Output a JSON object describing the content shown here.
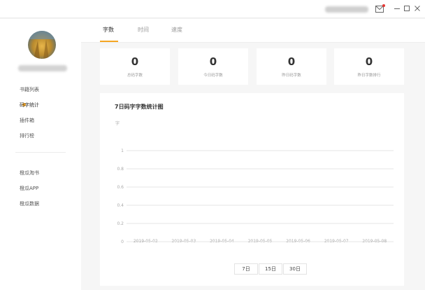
{
  "colors": {
    "accent": "#f5a623",
    "notify": "#e53935",
    "grid": "#e6e6e6",
    "axis_text": "#aaaaaa"
  },
  "titlebar": {
    "user_name_blurred": "",
    "icons": [
      "mail-icon",
      "minimize-icon",
      "maximize-icon",
      "close-icon"
    ]
  },
  "sidebar": {
    "items": [
      {
        "label": "书籍列表",
        "active": false
      },
      {
        "label": "码字统计",
        "active": true
      },
      {
        "label": "插件箱",
        "active": false
      },
      {
        "label": "排行榜",
        "active": false
      }
    ],
    "extra_items": [
      {
        "label": "橙瓜淘书"
      },
      {
        "label": "橙瓜APP"
      },
      {
        "label": "橙瓜数据"
      }
    ]
  },
  "tabs": [
    {
      "label": "字数",
      "active": true
    },
    {
      "label": "时间",
      "active": false
    },
    {
      "label": "速度",
      "active": false
    }
  ],
  "stats": [
    {
      "value": "0",
      "label": "总码字数"
    },
    {
      "value": "0",
      "label": "今日码字数"
    },
    {
      "value": "0",
      "label": "昨日码字数"
    },
    {
      "value": "0",
      "label": "昨日字数排行"
    }
  ],
  "chart": {
    "title": "7日码字字数统计图",
    "ylabel": "字"
  },
  "chart_data": {
    "type": "line",
    "title": "7日码字字数统计图",
    "xlabel": "",
    "ylabel": "字",
    "categories": [
      "2019-05-02",
      "2019-05-03",
      "2019-05-04",
      "2019-05-05",
      "2019-05-06",
      "2019-05-07",
      "2019-05-08"
    ],
    "y_ticks": [
      "0",
      "0.2",
      "0.4",
      "0.6",
      "0.8",
      "1"
    ],
    "ylim": [
      0,
      1
    ],
    "series": [
      {
        "values": [
          0,
          0,
          0,
          0,
          0,
          0,
          0
        ]
      }
    ],
    "grid": true
  },
  "range_buttons": [
    {
      "label": "7日",
      "active": true
    },
    {
      "label": "15日",
      "active": false
    },
    {
      "label": "30日",
      "active": false
    }
  ]
}
